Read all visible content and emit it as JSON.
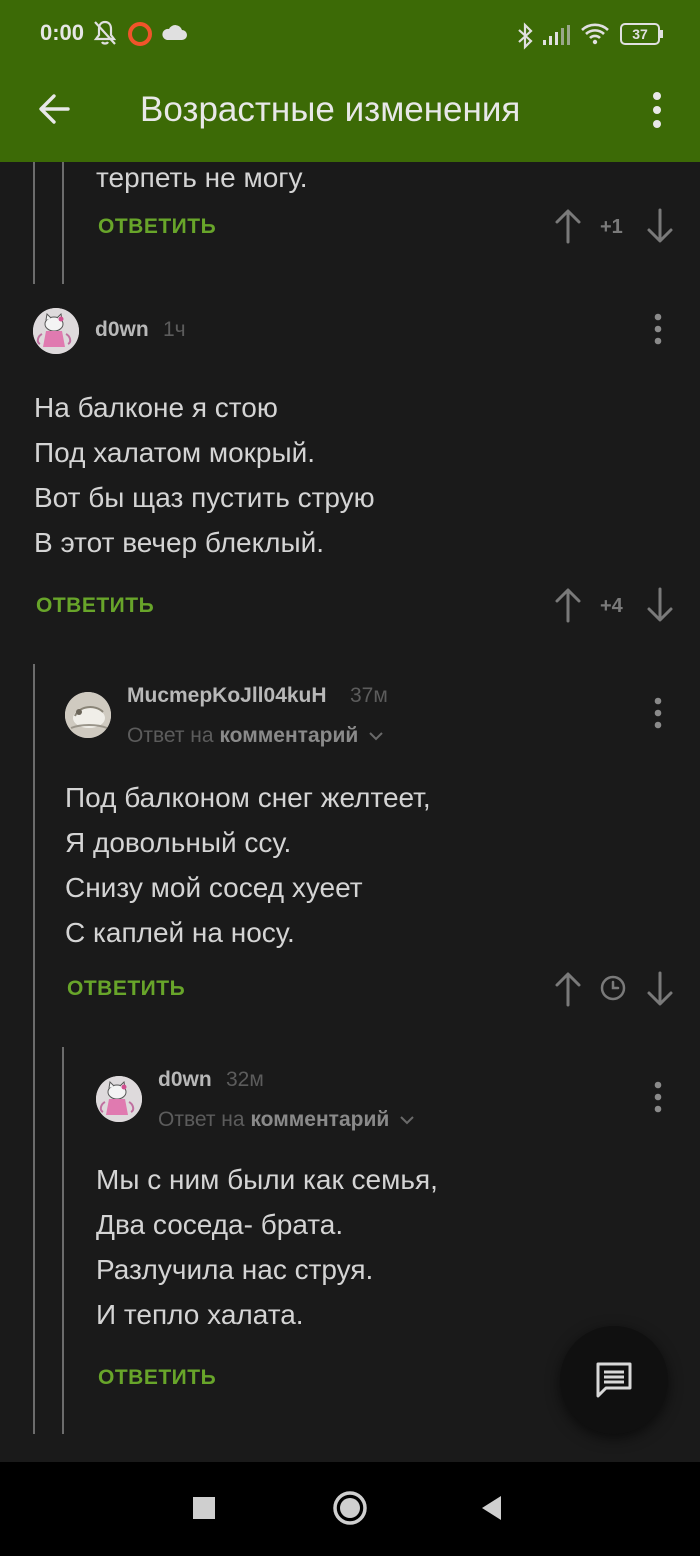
{
  "status_bar": {
    "time": "0:00",
    "battery": "37",
    "icons": [
      "bell-off-icon",
      "circle-icon",
      "cloud-icon",
      "bluetooth-icon",
      "signal-icon",
      "wifi-icon",
      "battery-icon"
    ]
  },
  "app_bar": {
    "title": "Возрастные изменения",
    "back_icon": "arrow-left-icon",
    "menu_icon": "more-vert-icon"
  },
  "colors": {
    "header": "#3c6a06",
    "background": "#1a1a1a",
    "reply": "#68a52a",
    "text": "#d4d4d4"
  },
  "comments": [
    {
      "partial_text": "терпеть не могу.",
      "reply_label": "ОТВЕТИТЬ",
      "rating": "+1"
    },
    {
      "author": "d0wn",
      "time": "1ч",
      "lines": [
        "На балконе я стою",
        "Под халатом  мокрый.",
        "Вот бы щаз пустить струю",
        "В этот вечер  блеклый."
      ],
      "reply_label": "ОТВЕТИТЬ",
      "rating": "+4"
    },
    {
      "author": "MucmepKoJll04kuH",
      "time": "37м",
      "reply_prefix": "Ответ на",
      "reply_target": "комментарий",
      "lines": [
        "Под балконом снег желтеет,",
        "Я довольный ссу.",
        "Снизу мой сосед хуеет",
        "С каплей на носу."
      ],
      "reply_label": "ОТВЕТИТЬ",
      "rating_icon": "clock-icon"
    },
    {
      "author": "d0wn",
      "time": "32м",
      "reply_prefix": "Ответ на",
      "reply_target": "комментарий",
      "lines": [
        "Мы с ним были  как семья,",
        "Два соседа- брата.",
        "Разлучила нас струя.",
        "И тепло халата."
      ],
      "reply_label": "ОТВЕТИТЬ"
    }
  ],
  "fab": {
    "icon": "comment-icon"
  },
  "nav_bar": {
    "icons": [
      "square-icon",
      "circle-home-icon",
      "triangle-back-icon"
    ]
  }
}
